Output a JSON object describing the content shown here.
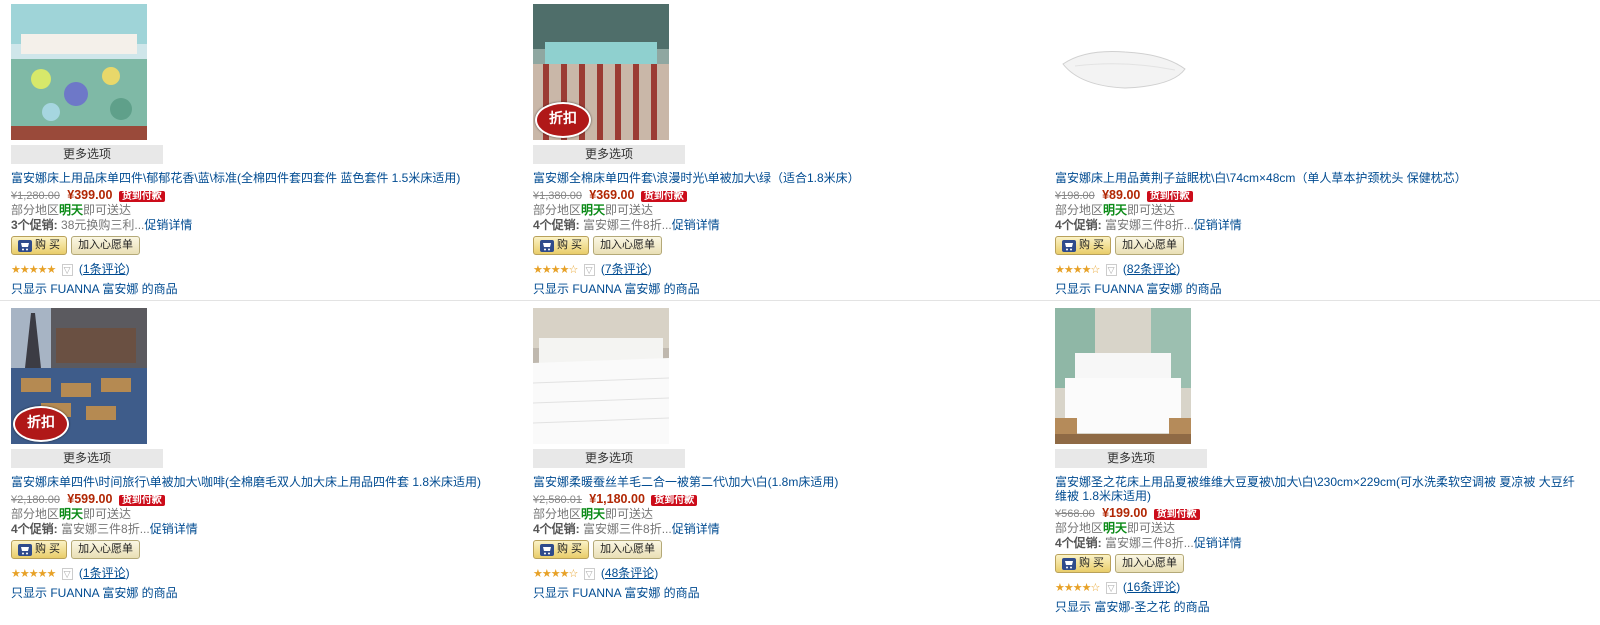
{
  "common": {
    "more_options": "更多选项",
    "buy_label": "购 买",
    "wishlist_label": "加入心愿单",
    "cod_badge": "货到付款",
    "delivery_prefix": "部分地区",
    "delivery_highlight": "明天",
    "delivery_suffix": "即可送达",
    "promo_details": "促销详情"
  },
  "products": [
    {
      "title": "富安娜床上用品床单四件\\郁郁花香\\蓝\\标准(全棉四件套四套件 蓝色套件 1.5米床适用)",
      "list_price": "¥1,280.00",
      "sale_price": "¥399.00",
      "promo_count": "3个促销:",
      "promo_text": "38元换购三利...",
      "stars": "★★★★★",
      "reviews": "1条评论",
      "brand_filter": "只显示 FUANNA 富安娜 的商品",
      "has_discount_badge": false,
      "discount_badge": "",
      "image": "floral-bedding"
    },
    {
      "title": "富安娜全棉床单四件套\\浪漫时光\\单被加大\\绿（适合1.8米床）",
      "list_price": "¥1,380.00",
      "sale_price": "¥369.00",
      "promo_count": "4个促销:",
      "promo_text": "富安娜三件8折...",
      "stars": "★★★★☆",
      "reviews": "7条评论",
      "brand_filter": "只显示 FUANNA 富安娜 的商品",
      "has_discount_badge": true,
      "discount_badge": "折扣",
      "image": "striped-bedding"
    },
    {
      "title": "富安娜床上用品黄荆子益眠枕\\白\\74cm×48cm（单人草本护颈枕头 保健枕芯）",
      "list_price": "¥198.00",
      "sale_price": "¥89.00",
      "promo_count": "4个促销:",
      "promo_text": "富安娜三件8折...",
      "stars": "★★★★☆",
      "reviews": "82条评论",
      "brand_filter": "只显示 FUANNA 富安娜 的商品",
      "has_discount_badge": false,
      "discount_badge": "",
      "image": "pillow"
    },
    {
      "title": "富安娜床单四件\\时间旅行\\单被加大\\咖啡(全棉磨毛双人加大床上用品四件套 1.8米床适用)",
      "list_price": "¥2,180.00",
      "sale_price": "¥599.00",
      "promo_count": "4个促销:",
      "promo_text": "富安娜三件8折...",
      "stars": "★★★★★",
      "reviews": "1条评论",
      "brand_filter": "只显示 FUANNA 富安娜 的商品",
      "has_discount_badge": true,
      "discount_badge": "折扣",
      "image": "paris-bedding"
    },
    {
      "title": "富安娜柔暖蚕丝羊毛二合一被第二代\\加大\\白(1.8m床适用)",
      "list_price": "¥2,580.01",
      "sale_price": "¥1,180.00",
      "promo_count": "4个促销:",
      "promo_text": "富安娜三件8折...",
      "stars": "★★★★☆",
      "reviews": "48条评论",
      "brand_filter": "只显示 FUANNA 富安娜 的商品",
      "has_discount_badge": false,
      "discount_badge": "",
      "image": "white-quilt"
    },
    {
      "title": "富安娜圣之花床上用品夏被维维大豆夏被\\加大\\白\\230cm×229cm(可水洗柔软空调被 夏凉被 大豆纤维被 1.8米床适用)",
      "list_price": "¥568.00",
      "sale_price": "¥199.00",
      "promo_count": "4个促销:",
      "promo_text": "富安娜三件8折...",
      "stars": "★★★★☆",
      "reviews": "16条评论",
      "brand_filter": "只显示 富安娜-圣之花 的商品",
      "has_discount_badge": false,
      "discount_badge": "",
      "image": "white-summer-quilt"
    }
  ]
}
